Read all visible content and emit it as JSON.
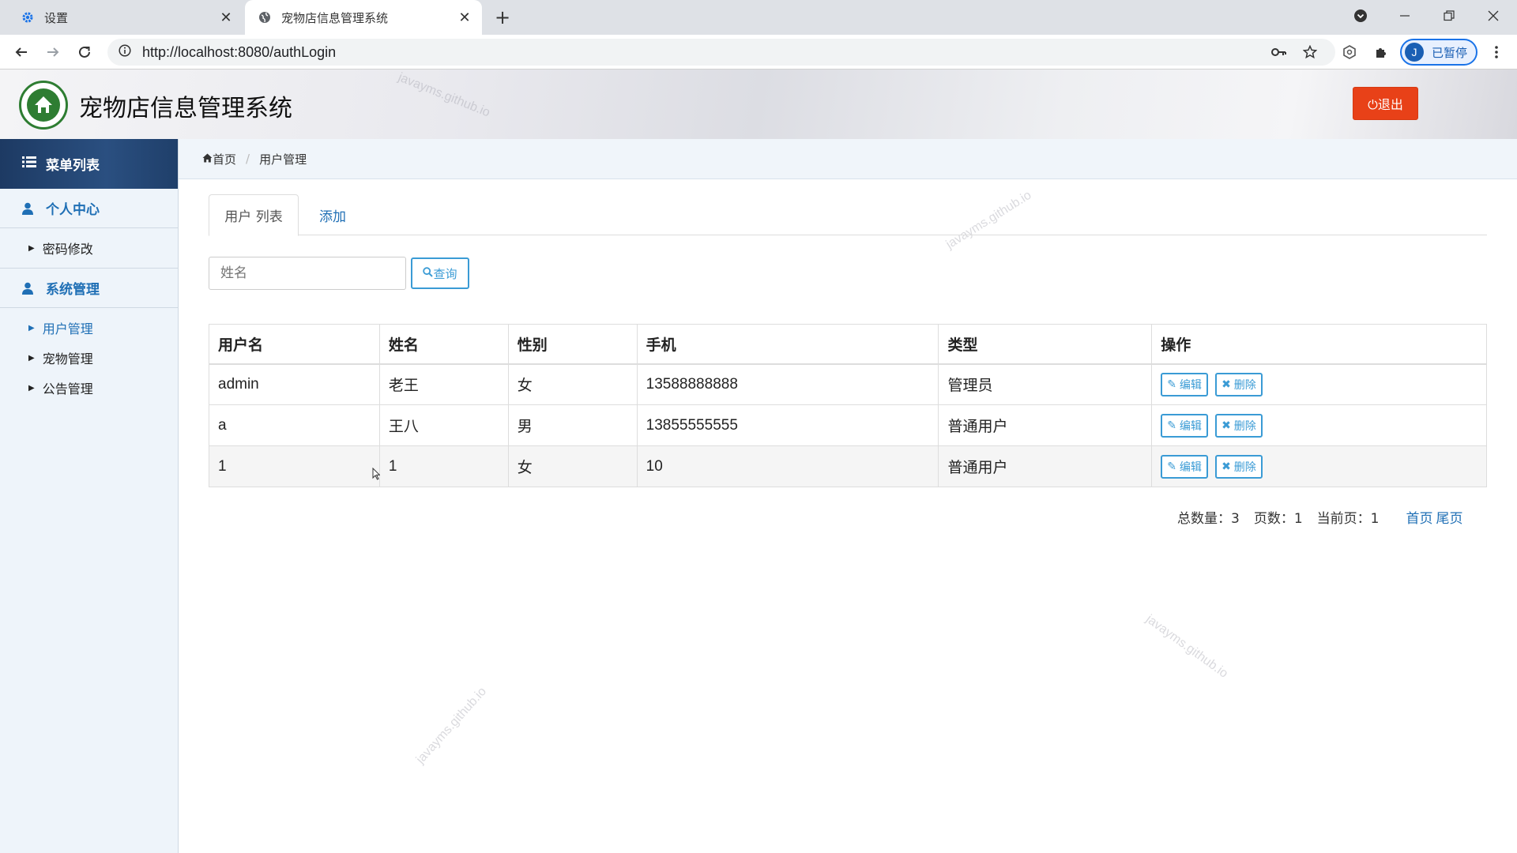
{
  "browser": {
    "tabs": [
      {
        "label": "设置",
        "icon": "gear-icon"
      },
      {
        "label": "宠物店信息管理系统",
        "icon": "globe-icon"
      }
    ],
    "url": "http://localhost:8080/authLogin",
    "profile": {
      "initial": "J",
      "label": "已暂停"
    }
  },
  "header": {
    "title": "宠物店信息管理系统",
    "logout_label": "⏻退出",
    "watermark": "javayms.github.io"
  },
  "sidebar": {
    "title": "菜单列表",
    "groups": [
      {
        "label": "个人中心",
        "items": [
          {
            "label": "密码修改"
          }
        ]
      },
      {
        "label": "系统管理",
        "items": [
          {
            "label": "用户管理"
          },
          {
            "label": "宠物管理"
          },
          {
            "label": "公告管理"
          }
        ]
      }
    ]
  },
  "breadcrumb": {
    "home": "首页",
    "current": "用户管理"
  },
  "content": {
    "tabs": [
      {
        "label": "用户 列表"
      },
      {
        "label": "添加"
      }
    ],
    "search": {
      "placeholder": "姓名",
      "button": "查询"
    },
    "table": {
      "headers": [
        "用户名",
        "姓名",
        "性别",
        "手机",
        "类型",
        "操作"
      ],
      "rows": [
        {
          "username": "admin",
          "name": "老王",
          "gender": "女",
          "phone": "13588888888",
          "type": "管理员"
        },
        {
          "username": "a",
          "name": "王八",
          "gender": "男",
          "phone": "13855555555",
          "type": "普通用户"
        },
        {
          "username": "1",
          "name": "1",
          "gender": "女",
          "phone": "10",
          "type": "普通用户"
        }
      ],
      "edit_label": "编辑",
      "delete_label": "删除"
    },
    "pager": {
      "total": "总数量：3",
      "pages": "页数：1",
      "current": "当前页：1",
      "first": "首页",
      "last": "尾页"
    }
  },
  "colors": {
    "accent": "#1f6fb5",
    "logout": "#e84118",
    "button_border": "#3a9bd5"
  }
}
